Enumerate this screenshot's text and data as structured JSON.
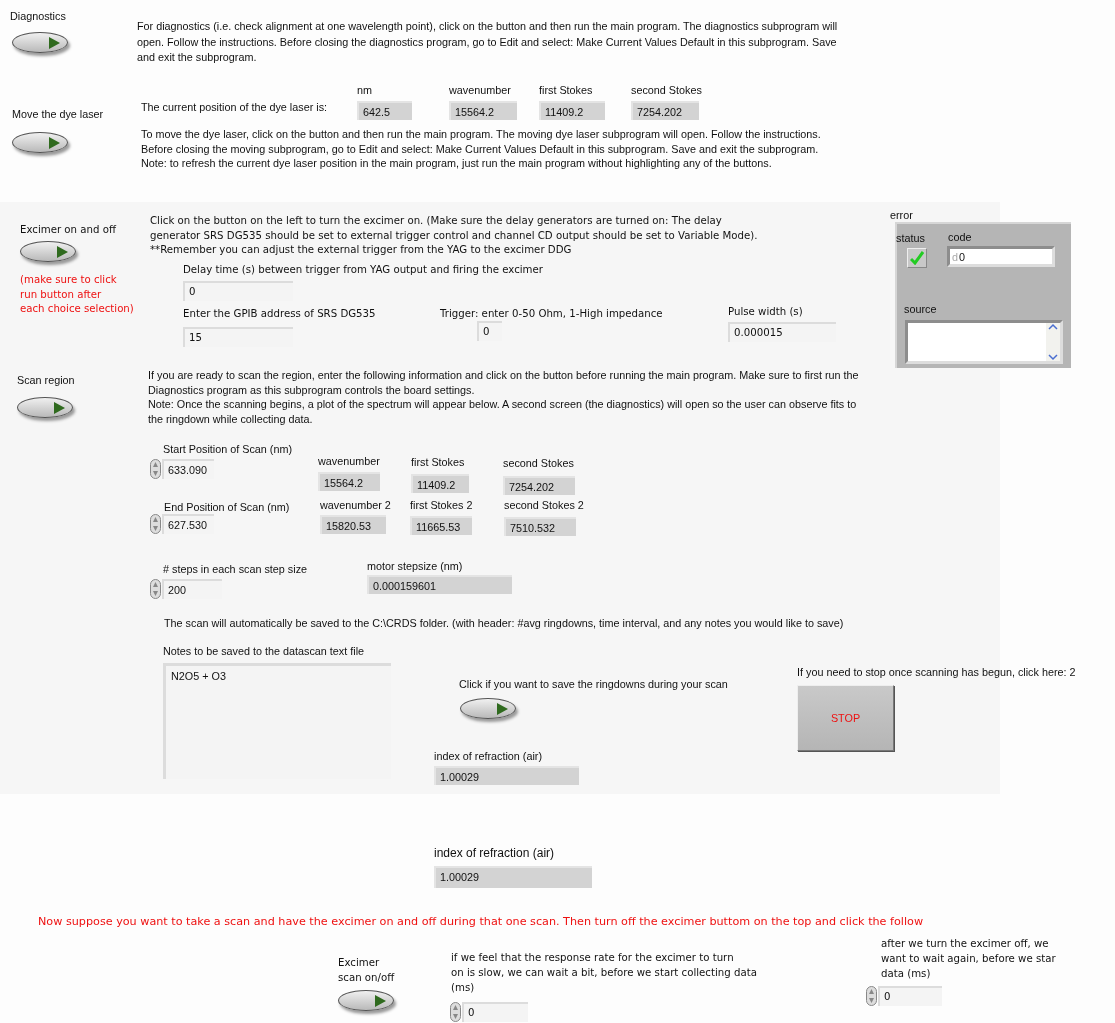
{
  "diagnostics": {
    "label": "Diagnostics",
    "lines": [
      "For diagnostics (i.e. check alignment at one wavelength point), click on the button and then run the main program.  The diagnostics subprogram will",
      "open.  Follow the instructions.  Before closing the diagnostics program, go to Edit and select: Make Current Values Default in this subprogram.  Save",
      "and exit the subprogram."
    ]
  },
  "dye_laser": {
    "label": "Move the dye laser",
    "position_label": "The current position of the dye laser is:",
    "readouts": [
      {
        "label": "nm",
        "value": "642.5"
      },
      {
        "label": "wavenumber",
        "value": "15564.2"
      },
      {
        "label": "first Stokes",
        "value": "11409.2"
      },
      {
        "label": "second Stokes",
        "value": "7254.202"
      }
    ],
    "lines": [
      "To move the dye laser, click on the button and then run the main program.  The moving dye laser subprogram will open.  Follow the instructions.",
      "Before closing the moving subprogram, go to Edit and select: Make Current Values Default in this subprogram.  Save and exit the subprogram.",
      "Note: to refresh the current dye laser position in the main program, just run the main program without highlighting any of the buttons."
    ]
  },
  "excimer": {
    "label": "Excimer on and off",
    "note_lines": [
      "(make sure to click",
      "run button after",
      "each choice selection)"
    ],
    "lines": [
      "Click on the button on the left to turn the excimer on.  (Make sure the delay generators are turned on:  The delay",
      "generator SRS DG535 should be set to external trigger control and channel CD output should be set to Variable Mode).",
      "**Remember you can adjust the external trigger from the YAG to the excimer DDG"
    ],
    "inputs": [
      {
        "label": "Delay time (s) between trigger from YAG output and firing the excimer",
        "value": "0"
      },
      {
        "label": "Enter the GPIB address of SRS DG535",
        "value": "15"
      },
      {
        "label": "Trigger: enter 0-50 Ohm, 1-High impedance",
        "value": "0"
      },
      {
        "label": "Pulse width (s)",
        "value": "0.000015"
      }
    ]
  },
  "error": {
    "label": "error",
    "status_label": "status",
    "status": false,
    "code_label": "code",
    "radix": "d",
    "code": "0",
    "source_label": "source"
  },
  "scan": {
    "label": "Scan region",
    "lines": [
      "If you are ready to scan the region, enter the following information and click on the button before running the main program.  Make sure to first run the",
      "Diagnostics program as this subprogram controls the board settings.",
      "Note:  Once the scanning begins, a plot of the spectrum will appear below.  A second screen (the diagnostics) will open so the user can observe fits to",
      "the ringdown while collecting data."
    ],
    "start": {
      "label": "Start Position of Scan (nm)",
      "value": "633.090"
    },
    "start_readouts": [
      {
        "label": "wavenumber",
        "value": "15564.2"
      },
      {
        "label": "first Stokes",
        "value": "11409.2"
      },
      {
        "label": "second Stokes",
        "value": "7254.202"
      }
    ],
    "end": {
      "label": "End Position of Scan (nm)",
      "value": "627.530"
    },
    "end_readouts": [
      {
        "label": "wavenumber  2",
        "value": "15820.53"
      },
      {
        "label": "first Stokes  2",
        "value": "11665.53"
      },
      {
        "label": "second Stokes  2",
        "value": "7510.532"
      }
    ],
    "steps": {
      "label": "# steps in each scan step size",
      "value": "200"
    },
    "stepsize": {
      "label": "motor stepsize (nm)",
      "value": "0.000159601"
    },
    "save_note": "The scan will automatically be saved to the C:\\CRDS folder.  (with header: #avg ringdowns, time interval, and any notes you would like to save)",
    "notes": {
      "label": "Notes to be saved to the datascan text file",
      "value": "N2O5 + O3"
    },
    "save_ringdowns": {
      "label": "Click if you want to save the ringdowns during your scan"
    },
    "refraction": {
      "label": "index of refraction (air)",
      "value": "1.00029"
    },
    "stop_prompt": "If you need to stop once scanning has begun, click here: 2",
    "stop_button": "STOP"
  },
  "refraction_2": {
    "label": "index of refraction (air)",
    "value": "1.00029"
  },
  "warning": "Now suppose you want to take a scan and have the excimer on and off during that one scan.  Then turn off the excimer buttom on the top and click the follow",
  "scan_toggle": {
    "label_lines": [
      "Excimer",
      "scan on/off"
    ]
  },
  "wait_on": {
    "lines": [
      "if we feel that the response rate for the excimer to turn",
      "on is slow, we can wait a bit, before we start collecting data",
      "(ms)"
    ],
    "value": "0"
  },
  "wait_off": {
    "lines": [
      "after we turn the excimer off, we",
      "want to wait again, before we star",
      "data (ms)"
    ],
    "value": "0"
  }
}
